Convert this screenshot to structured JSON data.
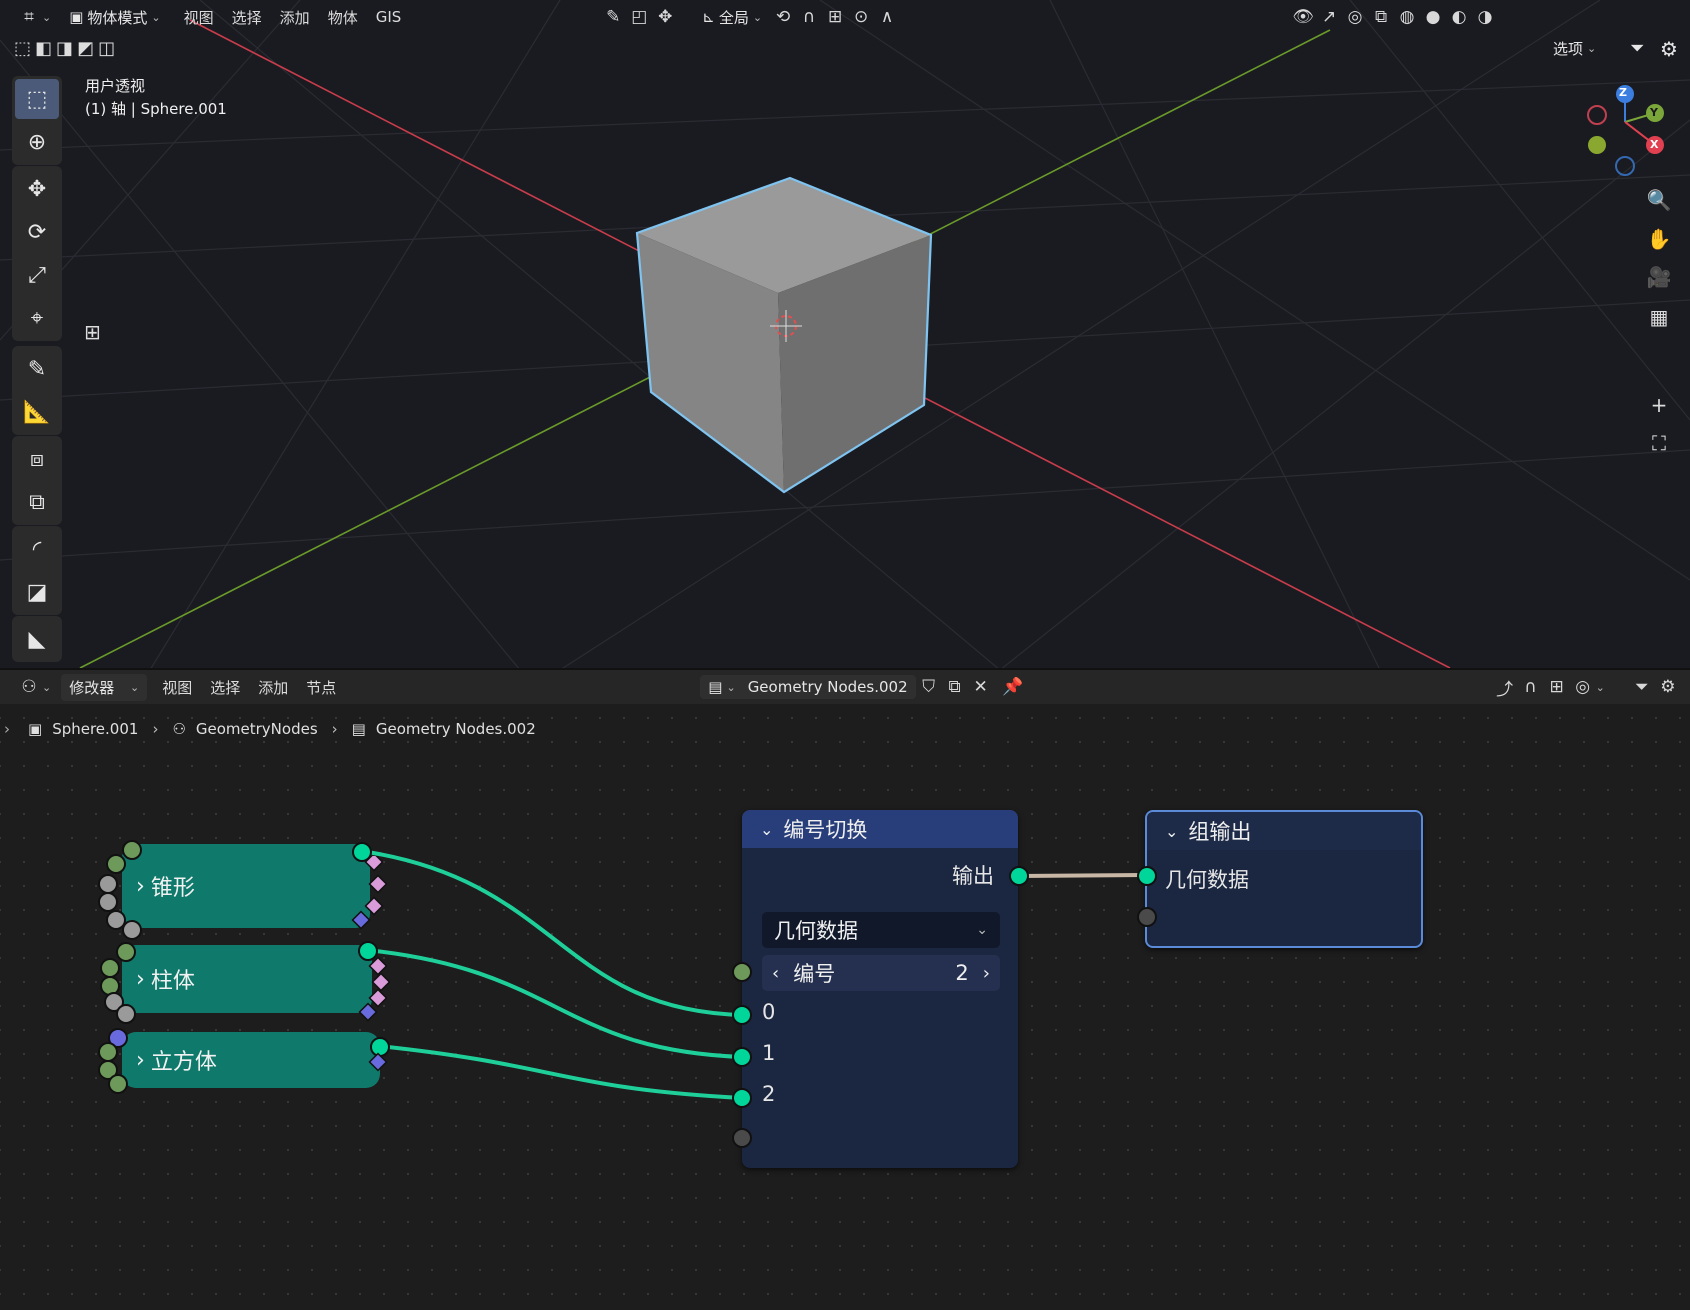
{
  "viewport": {
    "header": {
      "mode": "物体模式",
      "menus": [
        "视图",
        "选择",
        "添加",
        "物体",
        "GIS"
      ],
      "transform_orientation": "全局",
      "options_label": "选项"
    },
    "info": {
      "view_name": "用户透视",
      "object_line": "(1) 轴 | Sphere.001"
    },
    "gizmo": {
      "z": "Z",
      "y": "Y",
      "x": "X"
    },
    "colors": {
      "x_axis": "#c83c4b",
      "y_axis": "#6a9b2a",
      "selection": "#7fc4f0",
      "cube": "#8c8c8c"
    }
  },
  "node_editor": {
    "header": {
      "type": "修改器",
      "menus": [
        "视图",
        "选择",
        "添加",
        "节点"
      ],
      "node_group": "Geometry Nodes.002"
    },
    "breadcrumbs": [
      "Sphere.001",
      "GeometryNodes",
      "Geometry Nodes.002"
    ],
    "frames": [
      {
        "label": "锥形"
      },
      {
        "label": "柱体"
      },
      {
        "label": "立方体"
      }
    ],
    "index_switch": {
      "title": "编号切换",
      "output_label": "输出",
      "type_value": "几何数据",
      "index_label": "编号",
      "index_value": "2",
      "inputs": [
        "0",
        "1",
        "2"
      ]
    },
    "group_output": {
      "title": "组输出",
      "input_label": "几何数据"
    },
    "colors": {
      "geometry_socket": "#00d69a",
      "link": "#1fcf9a",
      "frame": "#0f7a6b",
      "node_header": "#283e7a"
    }
  }
}
